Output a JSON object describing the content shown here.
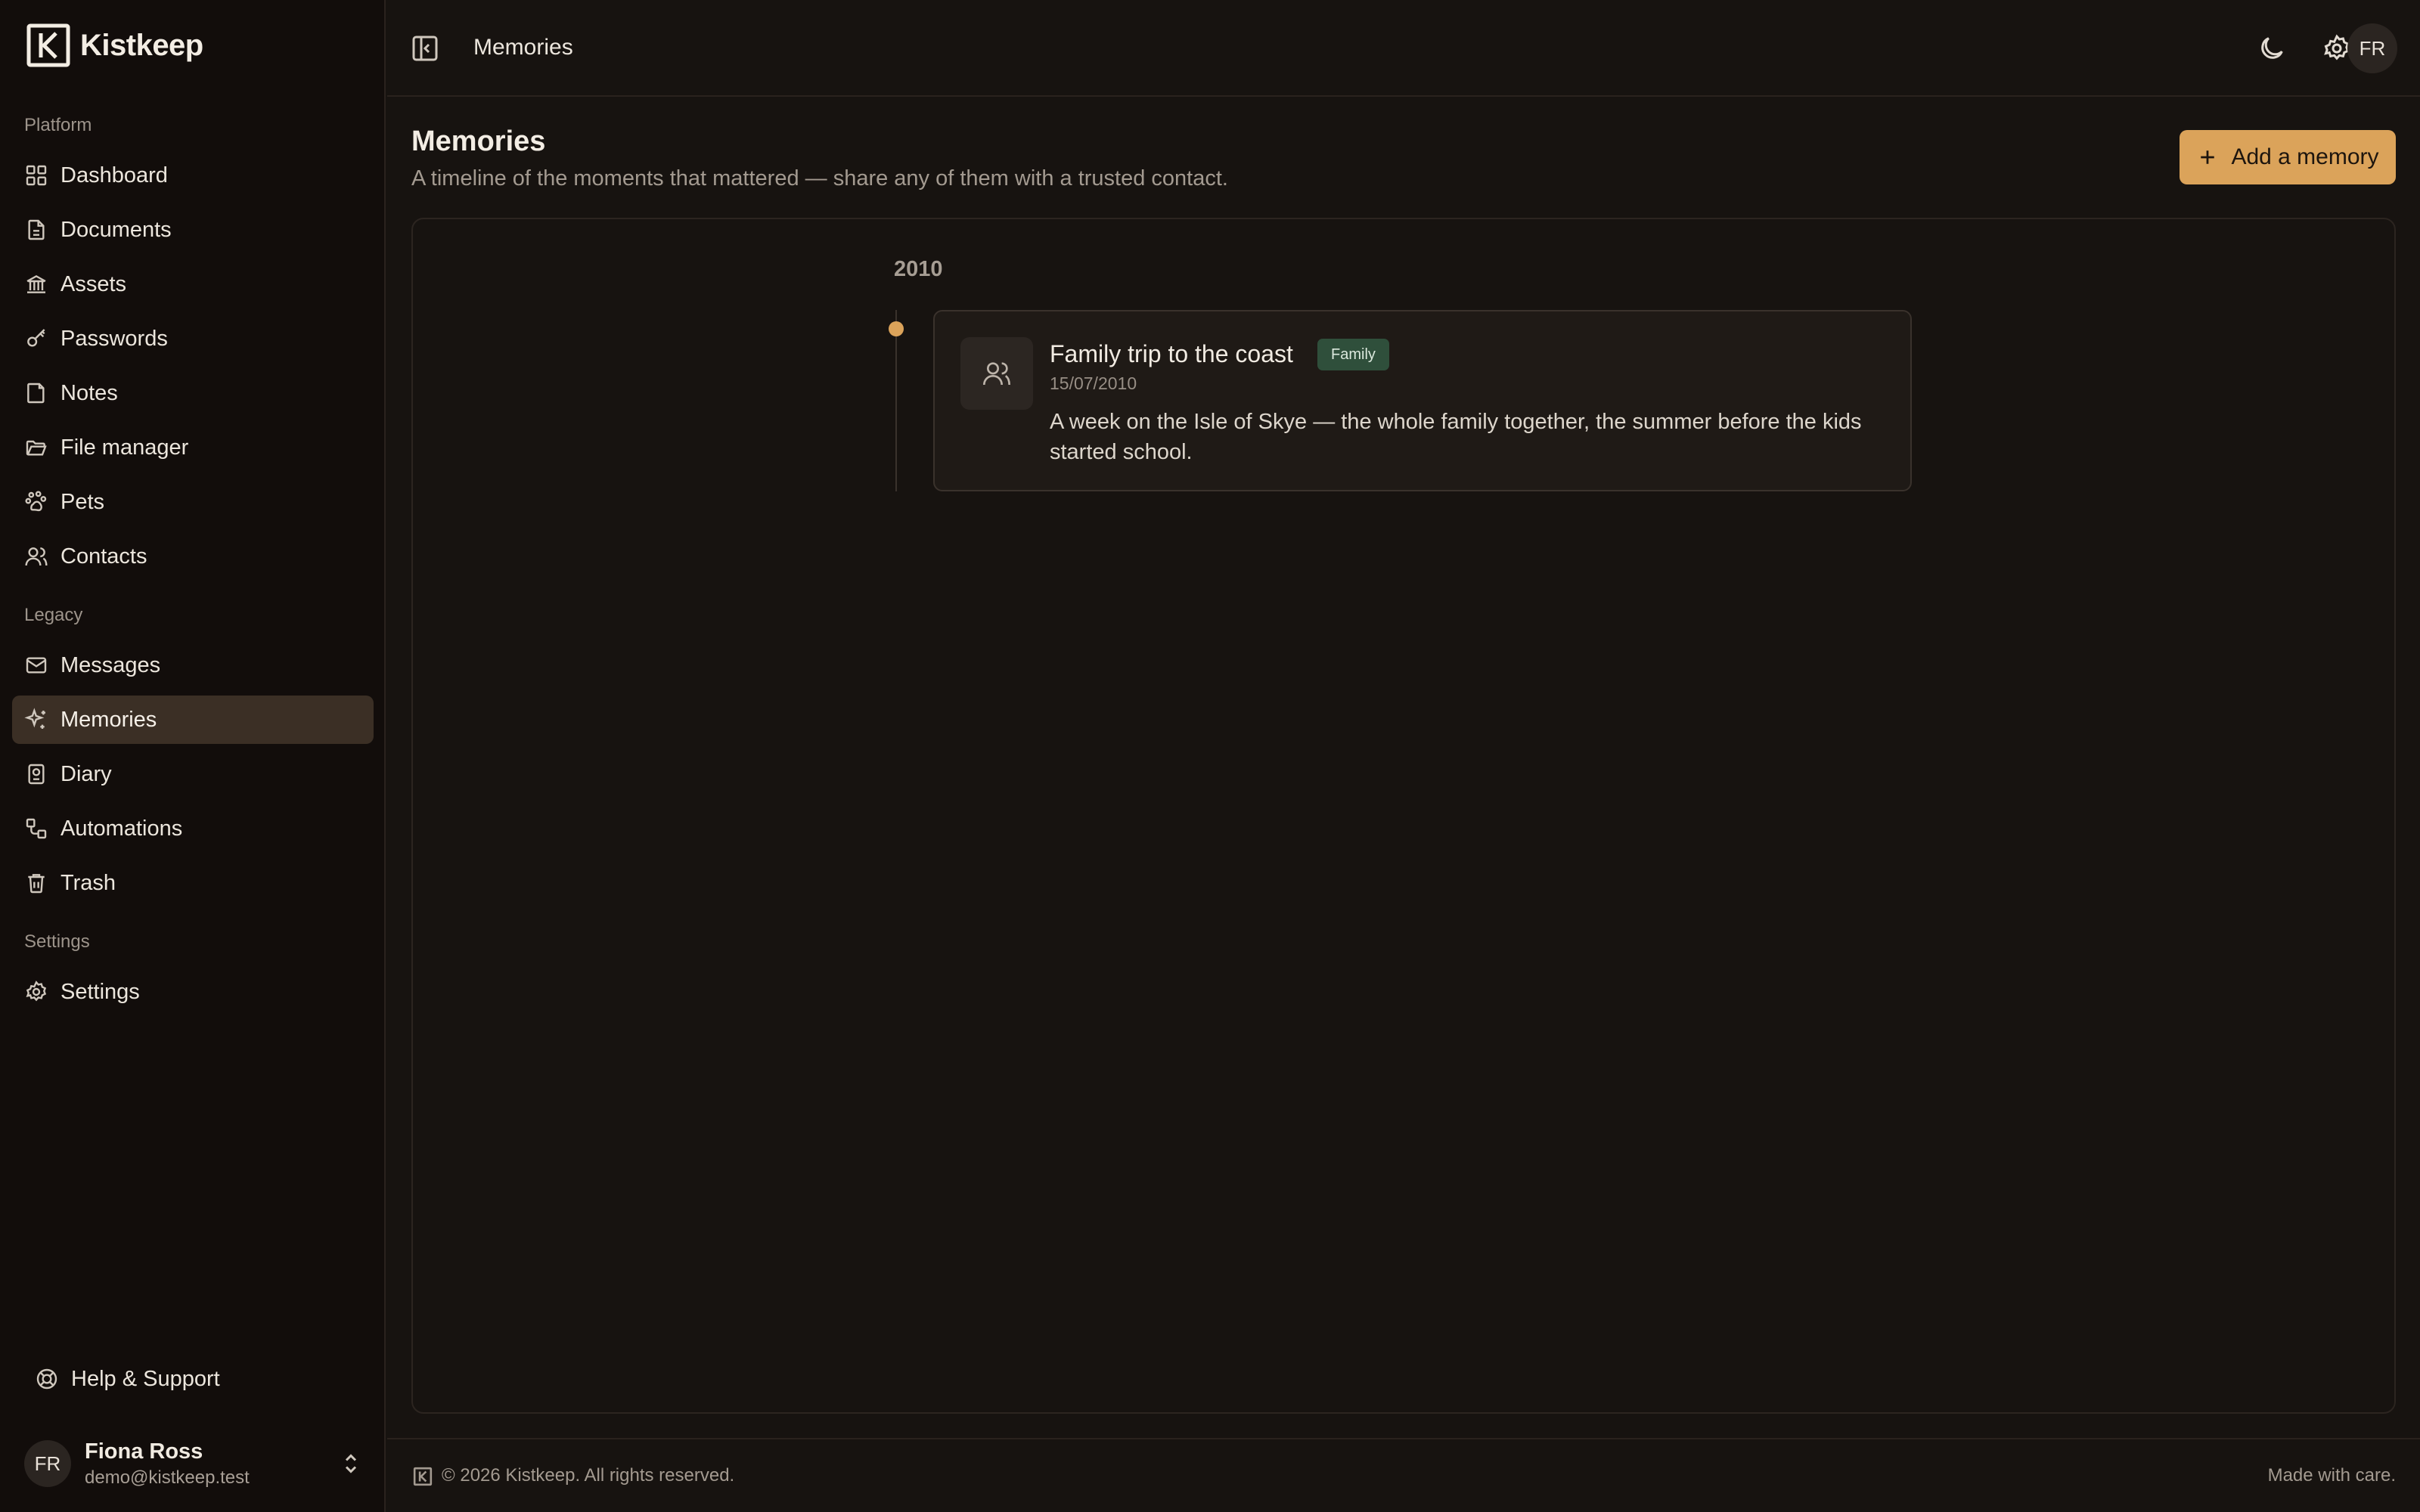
{
  "app": {
    "name": "Kistkeep"
  },
  "sidebar": {
    "sections": {
      "platform": "Platform",
      "legacy": "Legacy",
      "settings": "Settings"
    },
    "platform_items": [
      {
        "label": "Dashboard",
        "icon": "dashboard-icon"
      },
      {
        "label": "Documents",
        "icon": "document-icon"
      },
      {
        "label": "Assets",
        "icon": "bank-icon"
      },
      {
        "label": "Passwords",
        "icon": "key-icon"
      },
      {
        "label": "Notes",
        "icon": "note-icon"
      },
      {
        "label": "File manager",
        "icon": "folder-icon"
      },
      {
        "label": "Pets",
        "icon": "paw-icon"
      },
      {
        "label": "Contacts",
        "icon": "users-icon"
      }
    ],
    "legacy_items": [
      {
        "label": "Messages",
        "icon": "mail-icon"
      },
      {
        "label": "Memories",
        "icon": "sparkles-icon",
        "active": true
      },
      {
        "label": "Diary",
        "icon": "diary-icon"
      },
      {
        "label": "Automations",
        "icon": "workflow-icon"
      },
      {
        "label": "Trash",
        "icon": "trash-icon"
      }
    ],
    "settings_items": [
      {
        "label": "Settings",
        "icon": "gear-icon"
      }
    ],
    "help_label": "Help & Support",
    "user": {
      "initials": "FR",
      "name": "Fiona Ross",
      "email": "demo@kistkeep.test"
    }
  },
  "topbar": {
    "breadcrumb": "Memories",
    "avatar_initials": "FR"
  },
  "main": {
    "title": "Memories",
    "subtitle": "A timeline of the moments that mattered — share any of them with a trusted contact.",
    "add_button_label": "Add a memory",
    "timeline": [
      {
        "year": "2010",
        "entries": [
          {
            "title": "Family trip to the coast",
            "tag": "Family",
            "date": "15/07/2010",
            "description": "A week on the Isle of Skye — the whole family together, the summer before the kids started school.",
            "icon": "users-icon"
          }
        ]
      }
    ]
  },
  "footer": {
    "copyright": "© 2026 Kistkeep. All rights reserved.",
    "tagline": "Made with care."
  },
  "colors": {
    "accent": "#dba35a",
    "active_nav": "#3b2f25",
    "tag_family": "#2f4f3b",
    "background": "#171310",
    "sidebar": "#120d0b"
  }
}
